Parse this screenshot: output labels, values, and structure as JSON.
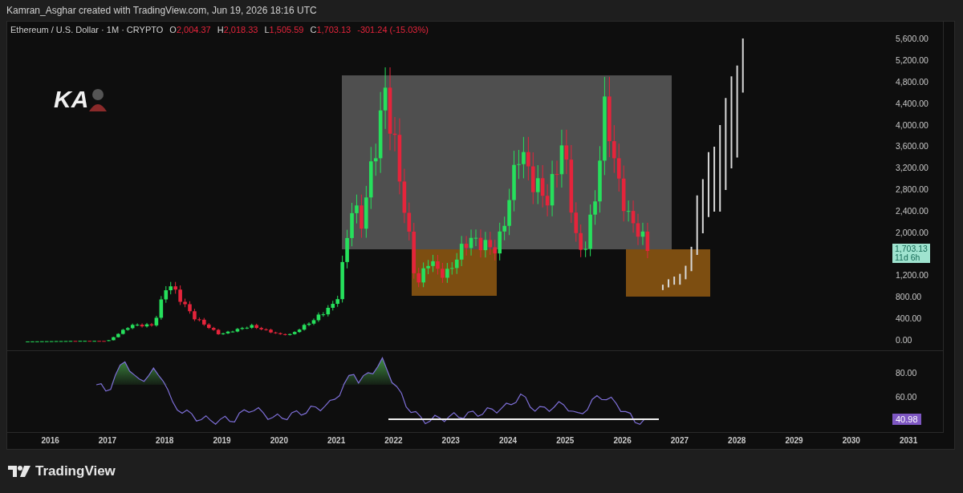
{
  "header": {
    "caption": "Kamran_Asghar created with TradingView.com, Jun 19, 2026 18:16 UTC"
  },
  "legend": {
    "symbol": "Ethereum / U.S. Dollar · 1M · CRYPTO",
    "falling": true,
    "ohlc": [
      {
        "label": "O",
        "value": "2,004.37"
      },
      {
        "label": "H",
        "value": "2,018.33"
      },
      {
        "label": "L",
        "value": "1,505.59"
      },
      {
        "label": "C",
        "value": "1,703.13"
      }
    ],
    "change": "-301.24 (-15.03%)"
  },
  "watermark": {
    "text": "KA"
  },
  "price_axis": {
    "ticks_upper": [
      "5,600.00",
      "5,200.00",
      "4,800.00",
      "4,400.00",
      "4,000.00",
      "3,600.00",
      "3,200.00",
      "2,800.00",
      "2,400.00",
      "2,000.00"
    ],
    "last_price": {
      "price": "1,703.13",
      "countdown": "11d 6h"
    },
    "ticks_lower": [
      "1,200.00",
      "800.00",
      "400.00",
      "0.00"
    ]
  },
  "rsi_axis": {
    "ticks": [
      "80.00",
      "60.00"
    ],
    "value": "40.98"
  },
  "time_axis": {
    "labels": [
      "2016",
      "2017",
      "2018",
      "2019",
      "2020",
      "2021",
      "2022",
      "2023",
      "2024",
      "2025",
      "2026",
      "2027",
      "2028",
      "2029",
      "2030",
      "2031"
    ]
  },
  "footer": {
    "brand": "TradingView"
  }
}
